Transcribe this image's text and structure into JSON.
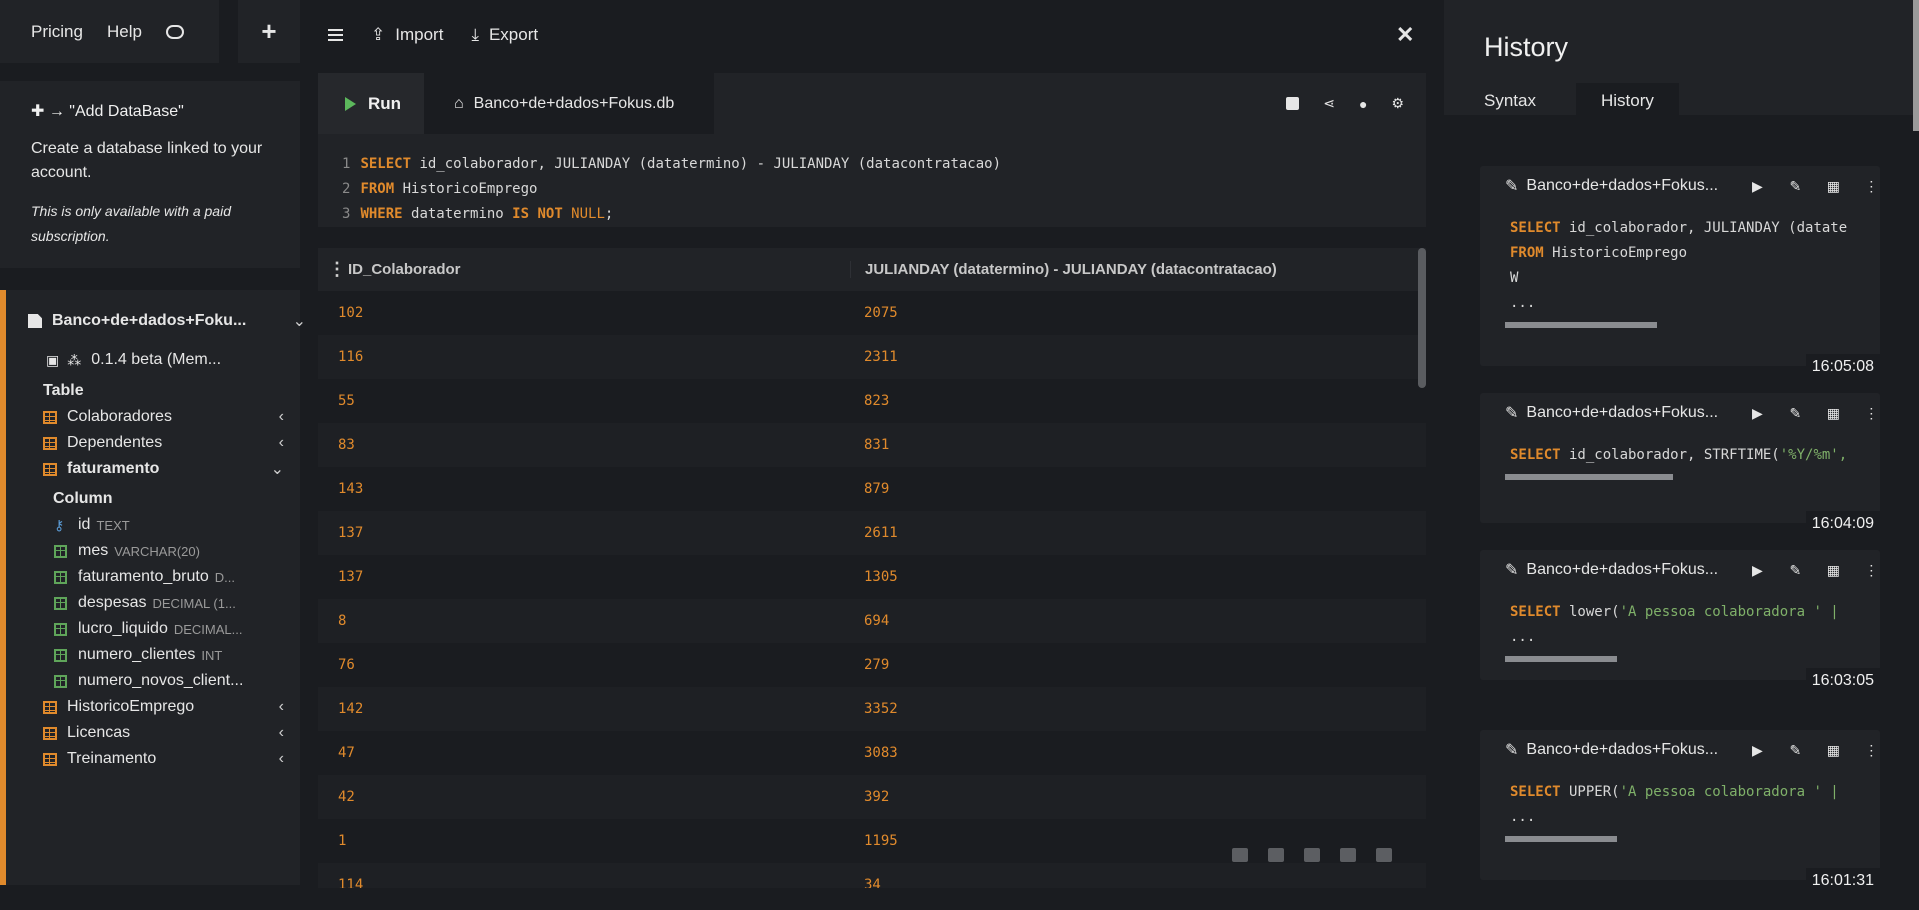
{
  "sidebar": {
    "top": {
      "pricing": "Pricing",
      "help": "Help"
    },
    "add_db": {
      "title": "✚ → \"Add DataBase\"",
      "desc": "Create a database linked to your account.",
      "note": "This is only available with a paid subscription."
    },
    "db_name": "Banco+de+dados+Foku...",
    "version": "0.1.4 beta (Mem...",
    "table_heading": "Table",
    "column_heading": "Column",
    "tables_before": [
      "Colaboradores",
      "Dependentes"
    ],
    "open_table": "faturamento",
    "columns": [
      {
        "name": "id",
        "type": "TEXT"
      },
      {
        "name": "mes",
        "type": "VARCHAR(20)"
      },
      {
        "name": "faturamento_bruto",
        "type": "D..."
      },
      {
        "name": "despesas",
        "type": "DECIMAL (1..."
      },
      {
        "name": "lucro_liquido",
        "type": "DECIMAL..."
      },
      {
        "name": "numero_clientes",
        "type": "INT"
      },
      {
        "name": "numero_novos_client...",
        "type": ""
      }
    ],
    "tables_after": [
      "HistoricoEmprego",
      "Licencas",
      "Treinamento"
    ]
  },
  "toolbar": {
    "import": "Import",
    "export": "Export",
    "run": "Run",
    "db_tab": "Banco+de+dados+Fokus.db"
  },
  "query_lines": [
    "SELECT id_colaborador, JULIANDAY (datatermino) - JULIANDAY (datacontratacao)",
    "FROM HistoricoEmprego",
    "WHERE datatermino IS NOT NULL;"
  ],
  "results": {
    "columns": [
      "ID_Colaborador",
      "JULIANDAY (datatermino) - JULIANDAY (datacontratacao)"
    ],
    "rows": [
      [
        "102",
        "2075"
      ],
      [
        "116",
        "2311"
      ],
      [
        "55",
        "823"
      ],
      [
        "83",
        "831"
      ],
      [
        "143",
        "879"
      ],
      [
        "137",
        "2611"
      ],
      [
        "137",
        "1305"
      ],
      [
        "8",
        "694"
      ],
      [
        "76",
        "279"
      ],
      [
        "142",
        "3352"
      ],
      [
        "47",
        "3083"
      ],
      [
        "42",
        "392"
      ],
      [
        "1",
        "1195"
      ],
      [
        "114",
        "34"
      ]
    ]
  },
  "history": {
    "title": "History",
    "tabs": [
      "Syntax",
      "History"
    ],
    "items": [
      {
        "title": "Banco+de+dados+Fokus...",
        "code": [
          "SELECT id_colaborador, JULIANDAY (datate",
          "FROM HistoricoEmprego",
          "W",
          "..."
        ],
        "time": "16:05:08",
        "bar": 0.6
      },
      {
        "title": "Banco+de+dados+Fokus...",
        "code": [
          "SELECT id_colaborador, STRFTIME('%Y/%m',"
        ],
        "time": "16:04:09",
        "bar": 0.66
      },
      {
        "title": "Banco+de+dados+Fokus...",
        "code": [
          "SELECT lower('A pessoa colaboradora ' |",
          "..."
        ],
        "time": "16:03:05",
        "bar": 0.44
      },
      {
        "title": "Banco+de+dados+Fokus...",
        "code": [
          "SELECT UPPER('A pessoa colaboradora ' |",
          "..."
        ],
        "time": "16:01:31",
        "bar": 0.44
      }
    ]
  }
}
